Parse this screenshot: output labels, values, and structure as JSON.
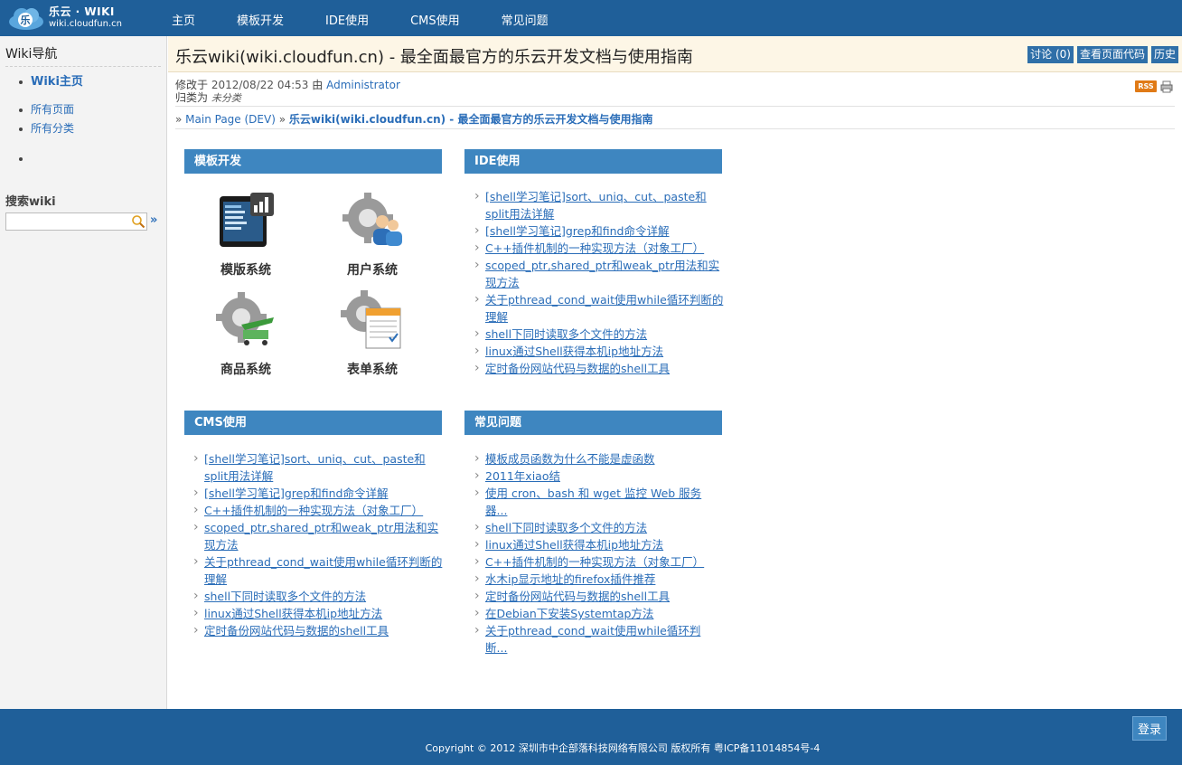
{
  "brand": {
    "title": "乐云 · WIKI",
    "subtitle": "wiki.cloudfun.cn",
    "icon_char": "乐"
  },
  "nav": [
    "主页",
    "模板开发",
    "IDE使用",
    "CMS使用",
    "常见问题"
  ],
  "sidebar": {
    "heading": "Wiki导航",
    "primary": "Wiki主页",
    "links": [
      "所有页面",
      "所有分类"
    ],
    "search_title": "搜索wiki",
    "search_value": "",
    "go": "»"
  },
  "page": {
    "title": "乐云wiki(wiki.cloudfun.cn) - 最全面最官方的乐云开发文档与使用指南",
    "actions": [
      "讨论 (0)",
      "查看页面代码",
      "历史"
    ],
    "meta": {
      "modified_label": "修改于",
      "date": "2012/08/22 04:53",
      "by_label": "由",
      "author": "Administrator",
      "category_label": "归类为",
      "category": "未分类"
    },
    "rss": "RSS",
    "breadcrumb": {
      "root": "Main Page (DEV)",
      "current": "乐云wiki(wiki.cloudfun.cn) - 最全面最官方的乐云开发文档与使用指南"
    }
  },
  "panels": {
    "template": {
      "title": "模板开发",
      "features": [
        "模版系统",
        "用户系统",
        "商品系统",
        "表单系统"
      ]
    },
    "ide": {
      "title": "IDE使用",
      "items": [
        "[shell学习笔记]sort、uniq、cut、paste和split用法详解",
        "[shell学习笔记]grep和find命令详解",
        "C++插件机制的一种实现方法（对象工厂）",
        "scoped_ptr,shared_ptr和weak_ptr用法和实现方法",
        "关于pthread_cond_wait使用while循环判断的理解",
        "shell下同时读取多个文件的方法",
        "linux通过Shell获得本机ip地址方法",
        "定时备份网站代码与数据的shell工具"
      ]
    },
    "cms": {
      "title": "CMS使用",
      "items": [
        "[shell学习笔记]sort、uniq、cut、paste和split用法详解",
        "[shell学习笔记]grep和find命令详解",
        "C++插件机制的一种实现方法（对象工厂）",
        "scoped_ptr,shared_ptr和weak_ptr用法和实现方法",
        "关于pthread_cond_wait使用while循环判断的理解",
        "shell下同时读取多个文件的方法",
        "linux通过Shell获得本机ip地址方法",
        "定时备份网站代码与数据的shell工具"
      ]
    },
    "faq": {
      "title": "常见问题",
      "items": [
        "模板成员函数为什么不能是虚函数",
        "2011年xiao结",
        "使用 cron、bash 和 wget 监控 Web 服务器...",
        "shell下同时读取多个文件的方法",
        "linux通过Shell获得本机ip地址方法",
        "C++插件机制的一种实现方法（对象工厂）",
        "水木ip显示地址的firefox插件推荐",
        "定时备份网站代码与数据的shell工具",
        "在Debian下安装Systemtap方法",
        "关于pthread_cond_wait使用while循环判断..."
      ]
    }
  },
  "footer": {
    "login": "登录",
    "copyright": "Copyright © 2012 深圳市中企部落科技网络有限公司 版权所有 粤ICP备11014854号-4"
  },
  "colors": {
    "header": "#1f5f99",
    "panel_head": "#3e86c0",
    "title_bg": "#fdf6e6",
    "link": "#2a6db8"
  }
}
